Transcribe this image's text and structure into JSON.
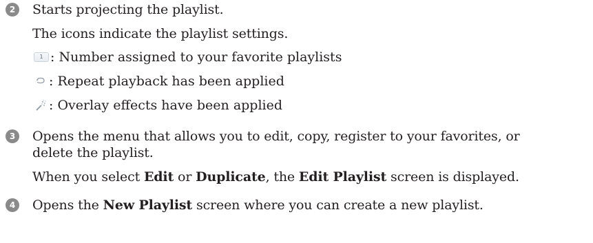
{
  "steps": [
    {
      "number": "2",
      "lines": [
        "Starts projecting the playlist.",
        "The icons indicate the playlist settings."
      ]
    },
    {
      "number": "3",
      "lines": [
        "Opens the menu that allows you to edit, copy, register to your favorites, or",
        "delete the playlist."
      ],
      "note": {
        "p1": "When you select ",
        "edit": "Edit",
        "p2": " or ",
        "duplicate": "Duplicate",
        "p3": ", the ",
        "edit_playlist": "Edit Playlist",
        "p4": " screen is displayed."
      }
    },
    {
      "number": "4",
      "parts": {
        "p1": "Opens the ",
        "new_playlist": "New Playlist",
        "p2": " screen where you can create a new playlist."
      }
    }
  ],
  "icon_legend": [
    {
      "icon": "favorite-number-icon",
      "glyph": "1",
      "text": ": Number assigned to your favorite playlists"
    },
    {
      "icon": "repeat-icon",
      "text": ": Repeat playback has been applied"
    },
    {
      "icon": "overlay-effects-icon",
      "text": ": Overlay effects have been applied"
    }
  ]
}
